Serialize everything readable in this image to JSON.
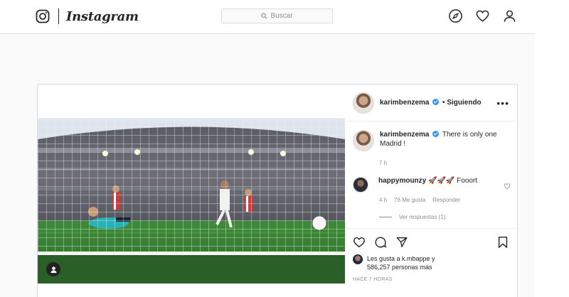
{
  "nav": {
    "brand": "Instagram",
    "search_placeholder": "Buscar",
    "icons": [
      "explore-icon",
      "heart-icon",
      "profile-icon"
    ]
  },
  "post": {
    "author": "karimbenzema",
    "verified": true,
    "follow_state": "• Siguiendo",
    "more": "•••",
    "caption": {
      "author": "karimbenzema",
      "text": "There is only one Madrid !",
      "time": "7 h"
    },
    "comments": [
      {
        "author": "happymounzy",
        "text": "🚀🚀🚀 Fooort",
        "time": "4 h",
        "likes": "76 Me gusta",
        "reply": "Responder",
        "view_replies": "Ver respuestas (1)"
      }
    ],
    "likes_line1": "Les gusta a k.mbappe y",
    "likes_line2": "586,257 personas más",
    "timestamp": "HACE 7 HORAS"
  },
  "colors": {
    "border": "#dbdbdb",
    "muted": "#8e8e8e",
    "verified": "#3897f0",
    "text": "#262626"
  }
}
